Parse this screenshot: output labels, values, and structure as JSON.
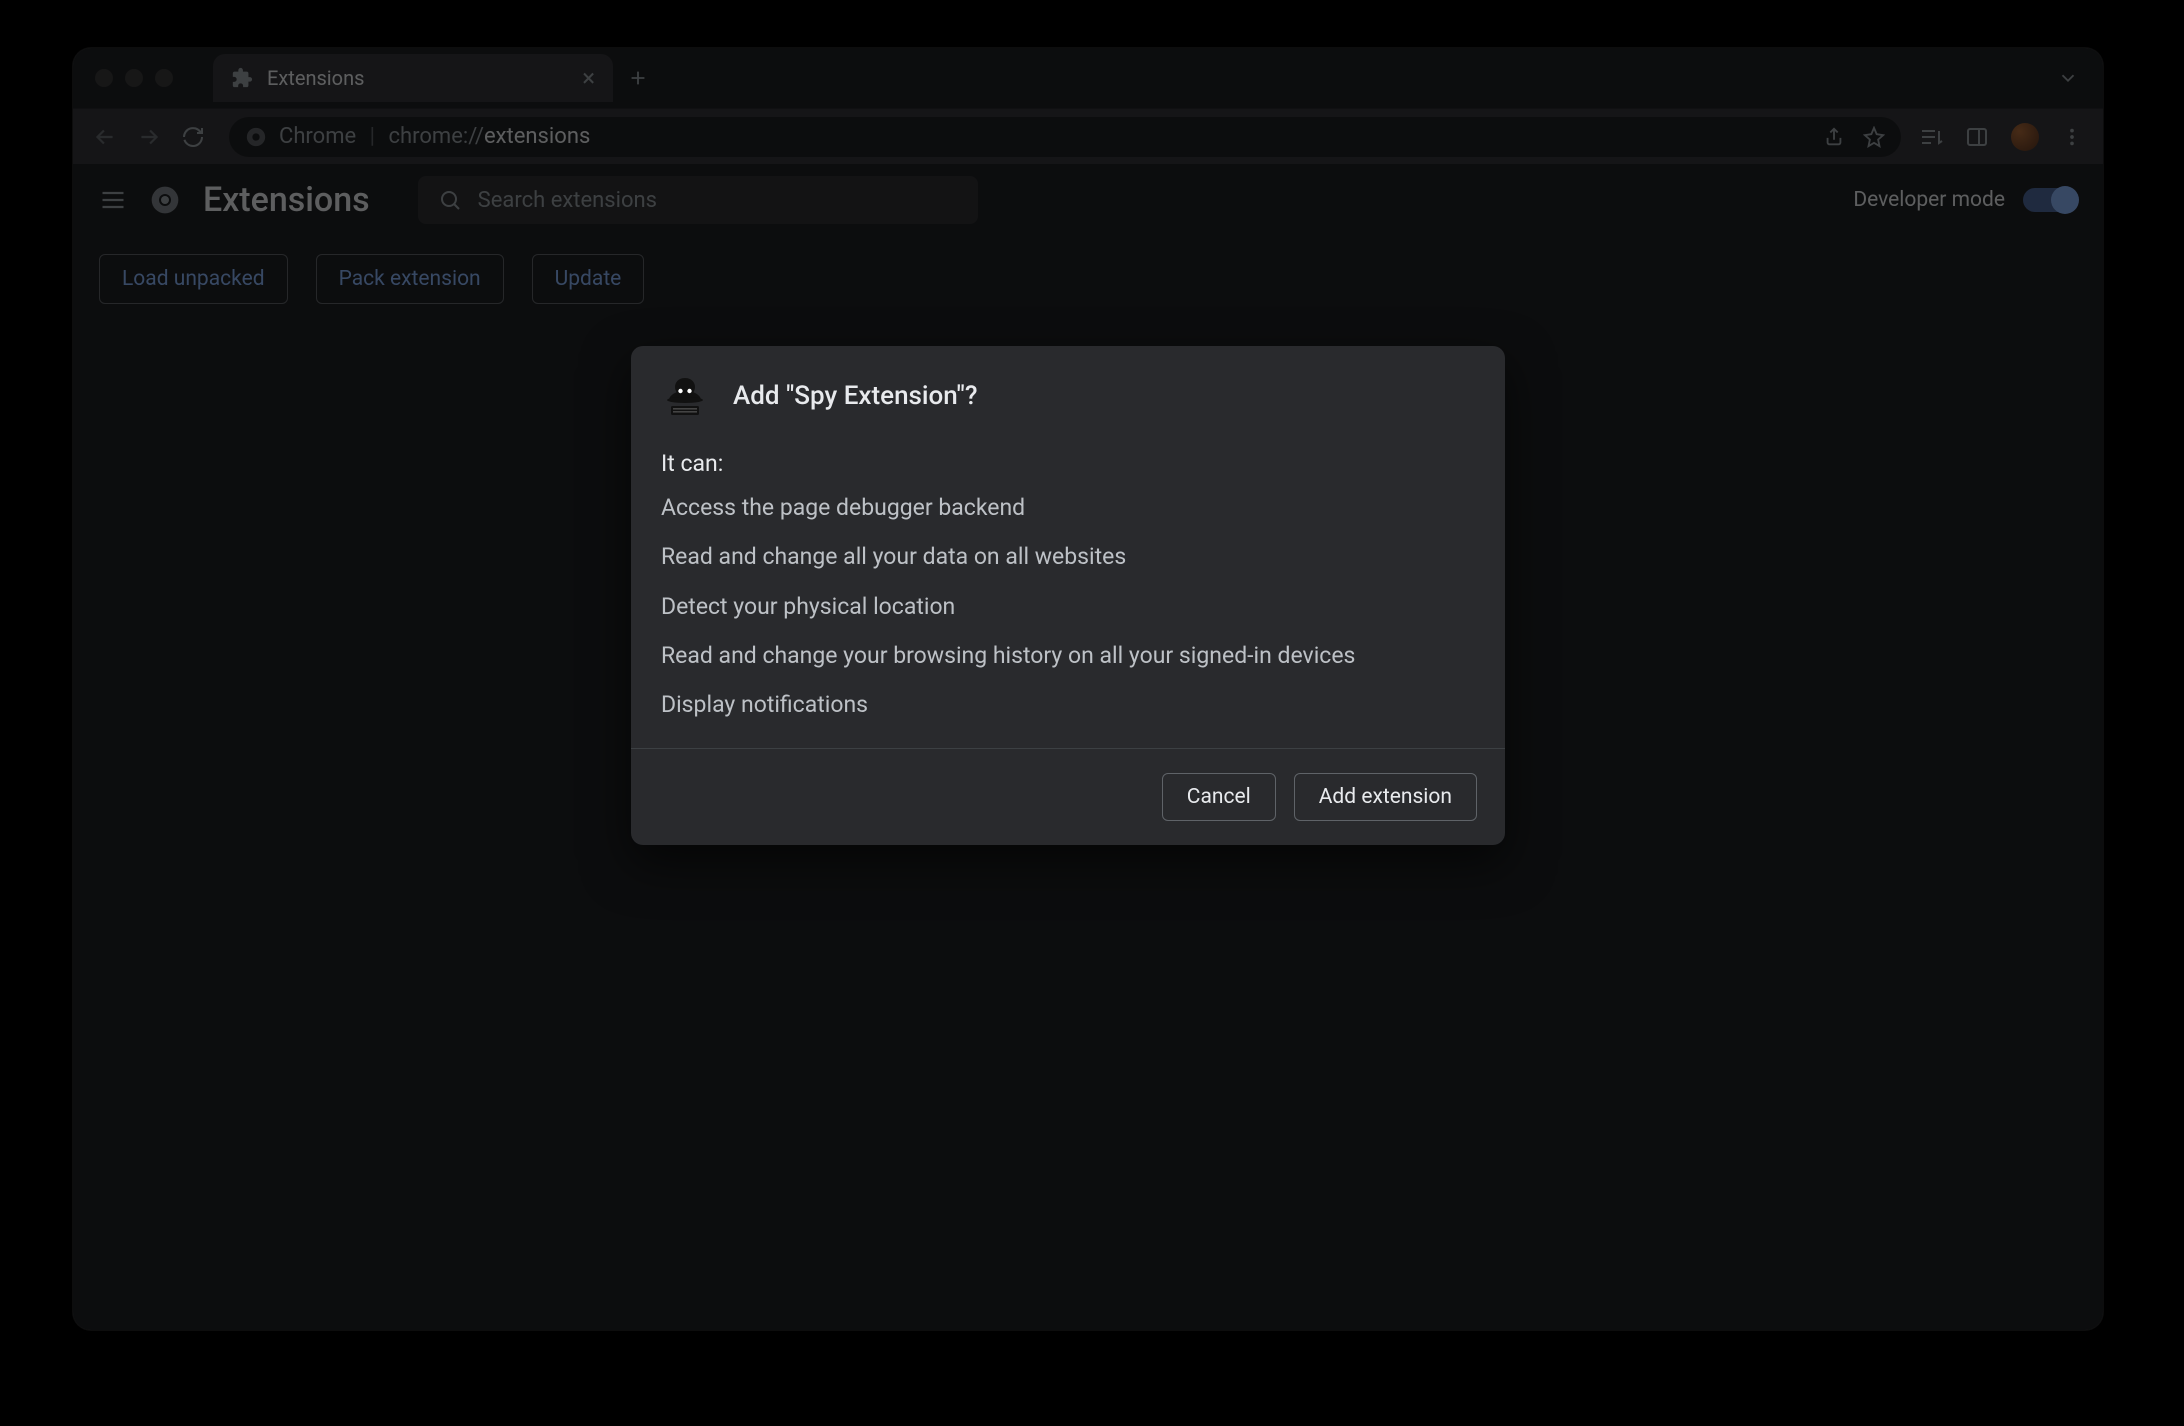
{
  "tabstrip": {
    "tab_title": "Extensions"
  },
  "urlbar": {
    "prefix": "Chrome",
    "scheme": "chrome://",
    "path": "extensions"
  },
  "appbar": {
    "title": "Extensions",
    "search_placeholder": "Search extensions",
    "dev_mode_label": "Developer mode",
    "dev_mode_on": true
  },
  "actions": {
    "load_unpacked": "Load unpacked",
    "pack_extension": "Pack extension",
    "update": "Update"
  },
  "dialog": {
    "title": "Add \"Spy Extension\"?",
    "heading": "It can:",
    "permissions": [
      "Access the page debugger backend",
      "Read and change all your data on all websites",
      "Detect your physical location",
      "Read and change your browsing history on all your signed-in devices",
      "Display notifications"
    ],
    "cancel": "Cancel",
    "confirm": "Add extension"
  }
}
